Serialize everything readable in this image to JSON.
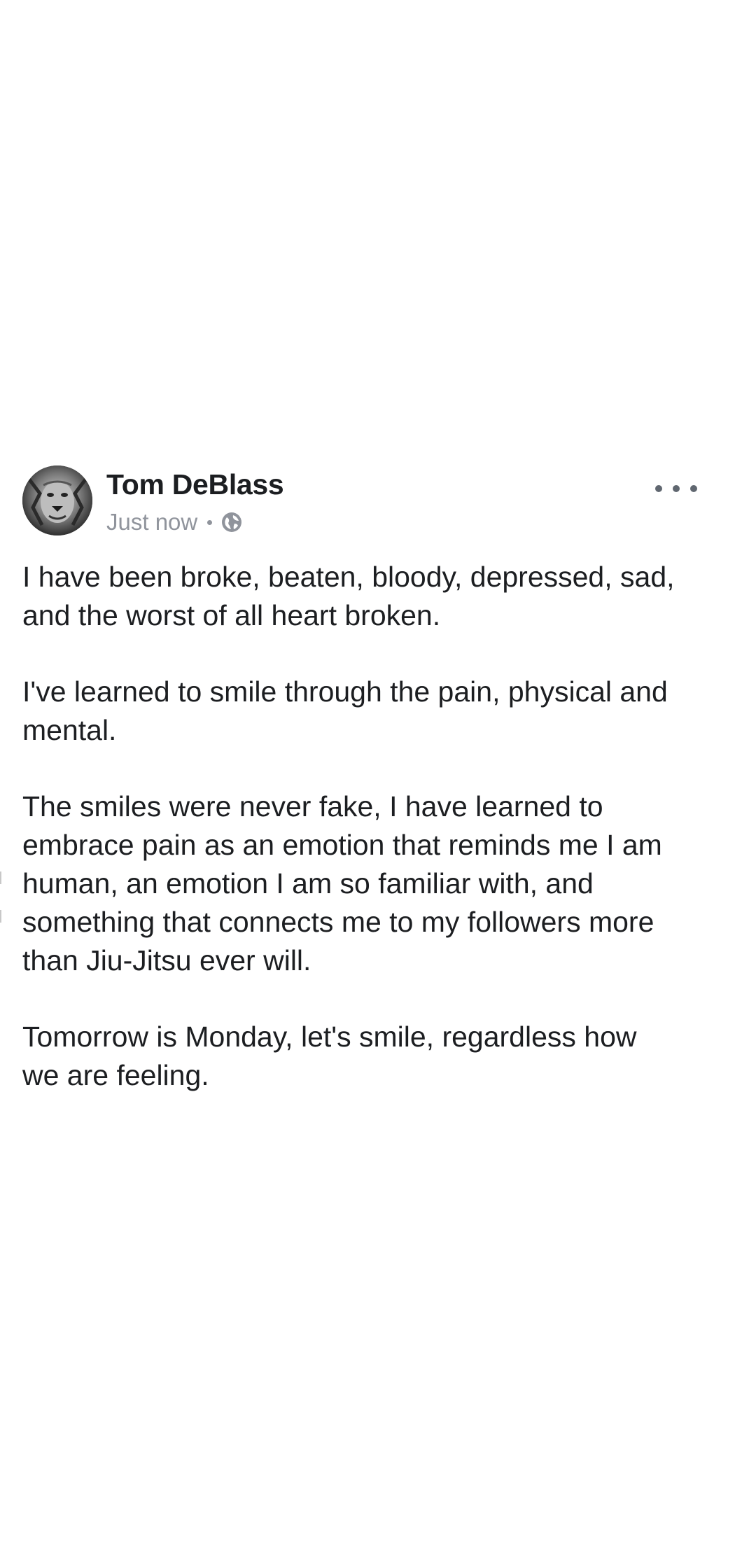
{
  "post": {
    "author": "Tom DeBlass",
    "timestamp": "Just now",
    "privacy_icon": "globe-icon",
    "more_icon": "more-options-icon",
    "paragraphs": [
      "I have been broke, beaten, bloody, depressed, sad,\nand the worst of all heart broken.",
      "I've learned to smile through the pain, physical and\nmental.",
      "The smiles were never fake, I have learned to\nembrace pain as an emotion that reminds me I am\nhuman, an emotion I am so familiar with, and\nsomething that connects me to my followers more\nthan Jiu-Jitsu ever will.",
      "Tomorrow is Monday, let's smile, regardless how\nwe are feeling."
    ]
  },
  "colors": {
    "text": "#1c1e21",
    "meta": "#90949c",
    "background": "#ffffff"
  }
}
